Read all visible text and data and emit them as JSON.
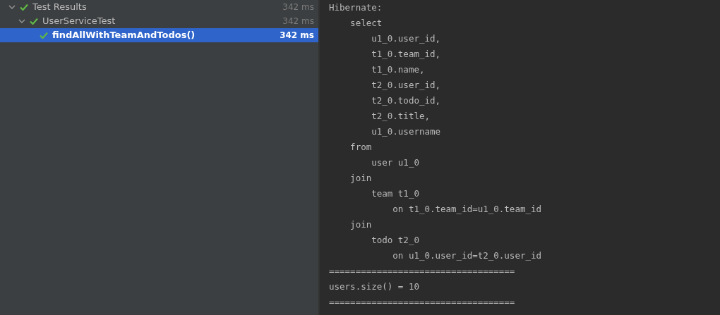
{
  "test_tree": [
    {
      "label": "Test Results",
      "time": "342 ms",
      "kind": "passed",
      "expanded": true,
      "selected": false,
      "children": [
        {
          "label": "UserServiceTest",
          "time": "342 ms",
          "kind": "passed",
          "expanded": true,
          "selected": false,
          "children": [
            {
              "label": "findAllWithTeamAndTodos()",
              "time": "342 ms",
              "kind": "passed",
              "selected": true
            }
          ]
        }
      ]
    }
  ],
  "console": {
    "lines": [
      "Hibernate:",
      "    select",
      "        u1_0.user_id,",
      "        t1_0.team_id,",
      "        t1_0.name,",
      "        t2_0.user_id,",
      "        t2_0.todo_id,",
      "        t2_0.title,",
      "        u1_0.username",
      "    from",
      "        user u1_0",
      "    join",
      "        team t1_0",
      "            on t1_0.team_id=u1_0.team_id",
      "    join",
      "        todo t2_0",
      "            on u1_0.user_id=t2_0.user_id",
      "===================================",
      "users.size() = 10",
      "==================================="
    ]
  }
}
